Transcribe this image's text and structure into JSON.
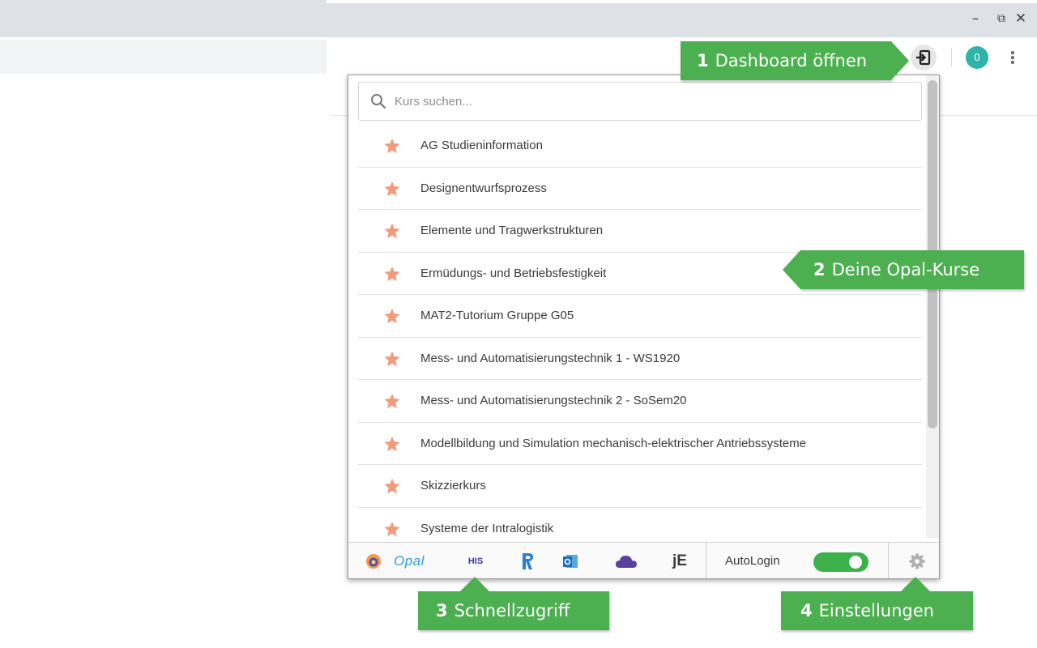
{
  "browser": {
    "window_controls": {
      "minimize": "–",
      "restore": "⧉",
      "close": "✕"
    },
    "extension_icon": "sign-in-icon",
    "avatar_text": "0",
    "menu_icon": "⋮"
  },
  "popup": {
    "search": {
      "placeholder": "Kurs suchen...",
      "value": ""
    },
    "courses": [
      {
        "label": "AG Studieninformation",
        "favorite": true
      },
      {
        "label": "Designentwurfsprozess",
        "favorite": true
      },
      {
        "label": "Elemente und Tragwerkstrukturen",
        "favorite": true
      },
      {
        "label": "Ermüdungs- und Betriebsfestigkeit",
        "favorite": true
      },
      {
        "label": "MAT2-Tutorium Gruppe G05",
        "favorite": true
      },
      {
        "label": "Mess- und Automatisierungstechnik 1 - WS1920",
        "favorite": true
      },
      {
        "label": "Mess- und Automatisierungstechnik 2 - SoSem20",
        "favorite": true
      },
      {
        "label": "Modellbildung und Simulation mechanisch-elektrischer Antriebssysteme",
        "favorite": true
      },
      {
        "label": "Skizzierkurs",
        "favorite": true
      },
      {
        "label": "Systeme der Intralogistik",
        "favorite": true
      }
    ],
    "footer": {
      "quick_links": [
        {
          "icon": "selma-icon"
        },
        {
          "icon": "opal-icon",
          "text": "Opal"
        },
        {
          "icon": "his-icon",
          "text": "HIS"
        },
        {
          "icon": "raum-icon"
        },
        {
          "icon": "outlook-icon"
        },
        {
          "icon": "cloud-icon"
        },
        {
          "icon": "jexam-icon",
          "text": "jE"
        }
      ],
      "autologin_label": "AutoLogin",
      "autologin_on": true,
      "settings_icon": "gear-icon"
    }
  },
  "callouts": [
    {
      "num": "1",
      "text": "Dashboard öffnen"
    },
    {
      "num": "2",
      "text": "Deine Opal-Kurse"
    },
    {
      "num": "3",
      "text": "Schnellzugriff"
    },
    {
      "num": "4",
      "text": "Einstellungen"
    }
  ],
  "colors": {
    "accent_green": "#4caf50",
    "star": "#f39a7b",
    "toggle_on": "#3db14b",
    "avatar": "#2eb5a8"
  }
}
